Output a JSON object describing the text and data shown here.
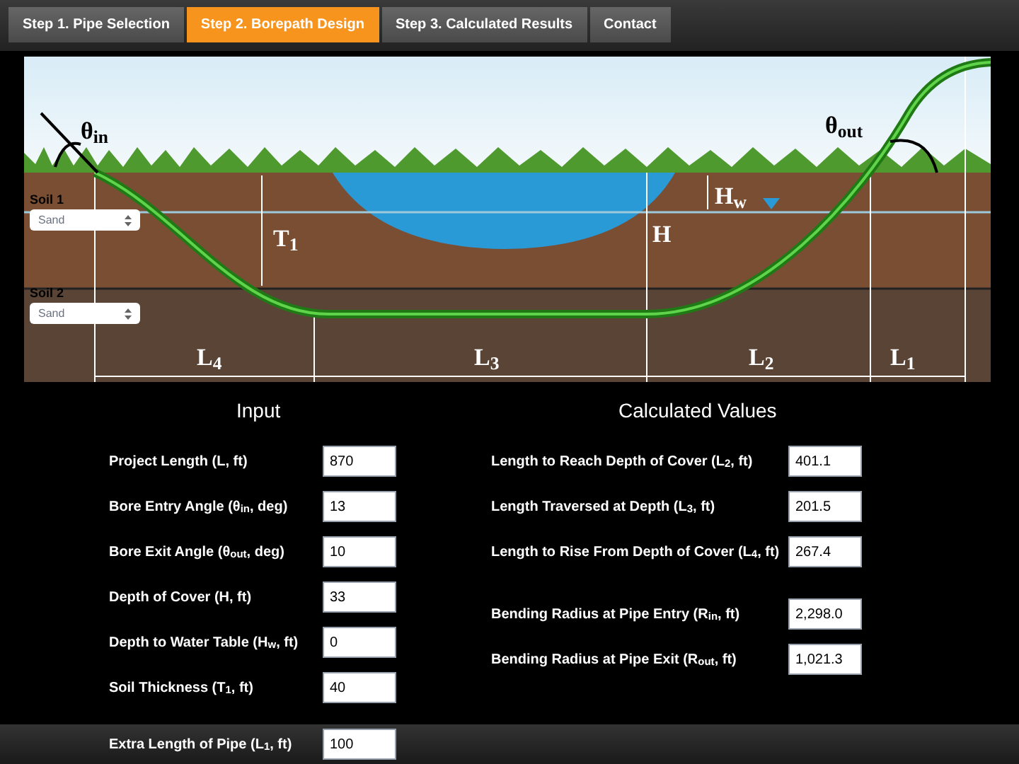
{
  "tabs": [
    {
      "label": "Step 1. Pipe Selection",
      "selected": false
    },
    {
      "label": "Step 2. Borepath Design",
      "selected": true
    },
    {
      "label": "Step 3. Calculated Results",
      "selected": false
    },
    {
      "label": "Contact",
      "selected": false
    }
  ],
  "diagram": {
    "theta_in": "θ$_{in}$",
    "theta_out": "θ$_{out}$",
    "hw": "H$_{w}$",
    "t1": "T$_{1}$",
    "h": "H",
    "l4": "L$_{4}$",
    "l3": "L$_{3}$",
    "l2": "L$_{2}$",
    "l1": "L$_{1}$",
    "soils": [
      {
        "label": "Soil 1",
        "value": "Sand"
      },
      {
        "label": "Soil 2",
        "value": "Sand"
      }
    ]
  },
  "input": {
    "title": "Input",
    "rows": [
      {
        "label": "Project Length (L, ft)",
        "value": "870"
      },
      {
        "label": "Bore Entry Angle (θ$_{in}$, deg)",
        "value": "13"
      },
      {
        "label": "Bore Exit Angle (θ$_{out}$, deg)",
        "value": "10"
      },
      {
        "label": "Depth of Cover (H, ft)",
        "value": "33"
      },
      {
        "label": "Depth to Water Table (H$_{w}$, ft)",
        "value": "0"
      },
      {
        "label": "Soil Thickness (T$_{1}$, ft)",
        "value": "40"
      },
      {
        "label": "Extra Length of Pipe (L$_{1}$, ft)",
        "value": "100"
      }
    ]
  },
  "calculated": {
    "title": "Calculated Values",
    "rows": [
      {
        "label": "Length to Reach Depth of Cover (L$_{2}$, ft)",
        "value": "401.1"
      },
      {
        "label": "Length Traversed at Depth (L$_{3}$, ft)",
        "value": "201.5"
      },
      {
        "label": "Length to Rise From Depth of Cover (L$_{4}$, ft)",
        "value": "267.4"
      },
      {
        "label": "Bending Radius at Pipe Entry (R$_{in}$, ft)",
        "value": "2,298.0"
      },
      {
        "label": "Bending Radius at Pipe Exit (R$_{out}$, ft)",
        "value": "1,021.3"
      }
    ]
  }
}
